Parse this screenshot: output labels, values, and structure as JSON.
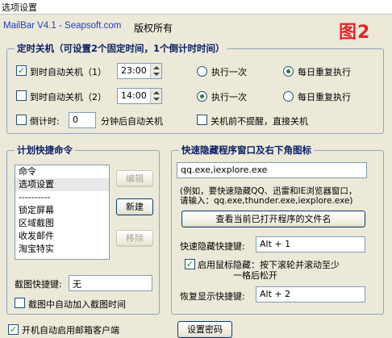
{
  "window": {
    "title": "选项设置"
  },
  "header": {
    "app_name": "MailBar V4.1 - Seapsoft.com",
    "copyright": "版权所有",
    "figure_label": "图2"
  },
  "colors": {
    "accent_blue": "#1f3fbf",
    "figure_red": "#e1262a",
    "legend_blue": "#0b1f66"
  },
  "shutdown": {
    "legend": "定时关机（可设置2个固定时间，1个倒计时时间）",
    "row1": {
      "label": "到时自动关机（1）",
      "checked": true,
      "time": "23:00",
      "opt_once": "执行一次",
      "opt_daily": "每日重复执行",
      "selected": "daily"
    },
    "row2": {
      "label": "到时自动关机（2）",
      "checked": false,
      "time": "14:00",
      "opt_once": "执行一次",
      "opt_daily": "每日重复执行",
      "selected": "once"
    },
    "countdown": {
      "label": "倒计时:",
      "value": "0",
      "suffix": "分钟后自动关机",
      "checked": false
    },
    "no_prompt": {
      "label": "关机前不提醒，直接关机",
      "checked": false
    }
  },
  "commands": {
    "legend": "计划快捷命令",
    "items": [
      "命令",
      "选项设置",
      "----------",
      "锁定屏幕",
      "区域截图",
      "收发邮件",
      "淘宝特实"
    ],
    "selected_index": 1,
    "edit_button": "编辑",
    "new_button": "新建",
    "remove_button": "移除",
    "screenshot_hotkey_label": "截图快捷键:",
    "screenshot_hotkey_value": "无",
    "add_time_label": "截图中自动加入截图时间",
    "add_time_checked": false
  },
  "hide": {
    "legend": "快速隐藏程序窗口及右下角图标",
    "programs_value": "qq.exe,iexplore.exe",
    "example_line1": "(例如，要快速隐藏QQ、迅雷和IE浏览器窗口，",
    "example_line2": "请输入：qq.exe,thunder.exe,iexplore.exe)",
    "view_button": "查看当前已打开程序的文件名",
    "hide_hotkey_label": "快速隐藏快捷键:",
    "hide_hotkey_value": "Alt + 1",
    "mouse_hide_label_line1": "启用鼠标隐藏：按下滚轮并滚动至少",
    "mouse_hide_label_line2": "一格后松开",
    "mouse_hide_checked": true,
    "restore_hotkey_label": "恢复显示快捷键:",
    "restore_hotkey_value": "Alt + 2"
  },
  "footer": {
    "autostart_label": "开机自动启用邮箱客户端",
    "autostart_checked": true,
    "password_button": "设置密码"
  }
}
